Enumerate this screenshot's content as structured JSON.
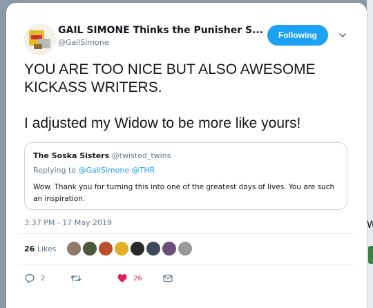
{
  "tweet": {
    "author": {
      "display_name": "GAIL SIMONE Thinks the Punisher S...",
      "handle": "@GailSimone",
      "avatar_icon": "avatar-image"
    },
    "follow_button": "Following",
    "text_line1": "YOU ARE TOO NICE BUT ALSO AWESOME KICKASS WRITERS.",
    "text_line2": "I adjusted my Widow to be more like yours!",
    "quoted": {
      "name": "The Soska Sisters",
      "handle": "@twisted_twins",
      "replying_prefix": "Replying to",
      "replying_to": "@GailSimone @THR",
      "text": "Wow. Thank you for turning this into one of the greatest days of lives. You are such an inspiration."
    },
    "timestamp": "3:37 PM - 17 May 2019",
    "likes_count": "26",
    "likes_label": "Likes",
    "likers": [
      "liker-1",
      "liker-2",
      "liker-3",
      "liker-4",
      "liker-5",
      "liker-6",
      "liker-7",
      "liker-8"
    ],
    "actions": {
      "reply_count": "2",
      "retweet_count": "",
      "like_count": "26"
    },
    "colors": {
      "accent": "#1da1f2",
      "like": "#e0245e",
      "secondary_text": "#657786"
    }
  },
  "side_peek": {
    "glyph": "W"
  }
}
